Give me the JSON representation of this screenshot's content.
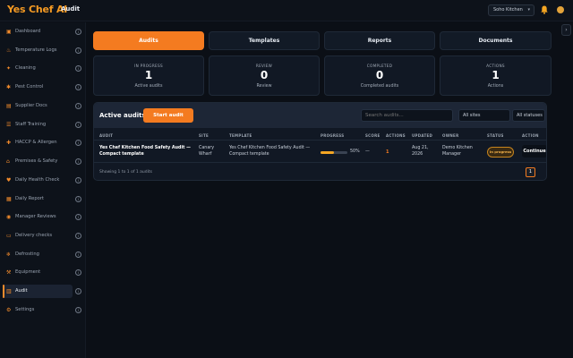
{
  "app": {
    "brand_main": "Yes Chef ",
    "brand_ai": "AI",
    "breadcrumb": "Audit"
  },
  "header": {
    "location": "Soho Kitchen",
    "chevron": "▾"
  },
  "edge_button": "›",
  "sidebar": {
    "items": [
      {
        "label": "Dashboard",
        "icon": "▣"
      },
      {
        "label": "Temperature Logs",
        "icon": "♨"
      },
      {
        "label": "Cleaning",
        "icon": "✦"
      },
      {
        "label": "Pest Control",
        "icon": "✱"
      },
      {
        "label": "Supplier Docs",
        "icon": "▤"
      },
      {
        "label": "Staff Training",
        "icon": "☰"
      },
      {
        "label": "HACCP & Allergen",
        "icon": "✚"
      },
      {
        "label": "Premises & Safety",
        "icon": "⌂"
      },
      {
        "label": "Daily Health Check",
        "icon": "♥"
      },
      {
        "label": "Daily Report",
        "icon": "▦"
      },
      {
        "label": "Manager Reviews",
        "icon": "◉"
      },
      {
        "label": "Delivery checks",
        "icon": "▭"
      },
      {
        "label": "Defrosting",
        "icon": "❄"
      },
      {
        "label": "Equipment",
        "icon": "⚒"
      },
      {
        "label": "Audit",
        "icon": "▥"
      },
      {
        "label": "Settings",
        "icon": "⚙"
      }
    ],
    "info_glyph": "i",
    "active_index": 14
  },
  "tabs": [
    "Audits",
    "Templates",
    "Reports",
    "Documents"
  ],
  "stats": [
    {
      "heading": "IN PROGRESS",
      "value": "1",
      "sub": "Active audits"
    },
    {
      "heading": "REVIEW",
      "value": "0",
      "sub": "Review"
    },
    {
      "heading": "COMPLETED",
      "value": "0",
      "sub": "Completed audits"
    },
    {
      "heading": "ACTIONS",
      "value": "1",
      "sub": "Actions"
    }
  ],
  "audits": {
    "title": "Active audits",
    "start_button": "Start audit",
    "search_placeholder": "Search audits...",
    "site_filter": "All sites",
    "status_filter": "All statuses",
    "columns": [
      "AUDIT",
      "SITE",
      "TEMPLATE",
      "PROGRESS",
      "SCORE",
      "ACTIONS",
      "UPDATED",
      "OWNER",
      "STATUS",
      "ACTION"
    ],
    "rows": [
      {
        "audit_line1": "Yes Chef Kitchen Food Safety Audit —",
        "audit_line2": "Compact template",
        "site_line1": "Canary",
        "site_line2": "Wharf",
        "template_line1": "Yes Chef Kitchen Food Safety Audit —",
        "template_line2": "Compact template",
        "progress_label": "50%",
        "progress_fraction": 0.5,
        "score": "—",
        "actions": "1",
        "updated_line1": "Aug 21,",
        "updated_line2": "2026",
        "owner_line1": "Demo Kitchen",
        "owner_line2": "Manager",
        "status": "In progress",
        "action": "Continue"
      }
    ],
    "footer": "Showing 1 to 1 of 1 audits",
    "page": "1"
  },
  "colors": {
    "accent": "#f47b20",
    "progress": "#f5a623",
    "brand": "#f59a23"
  }
}
